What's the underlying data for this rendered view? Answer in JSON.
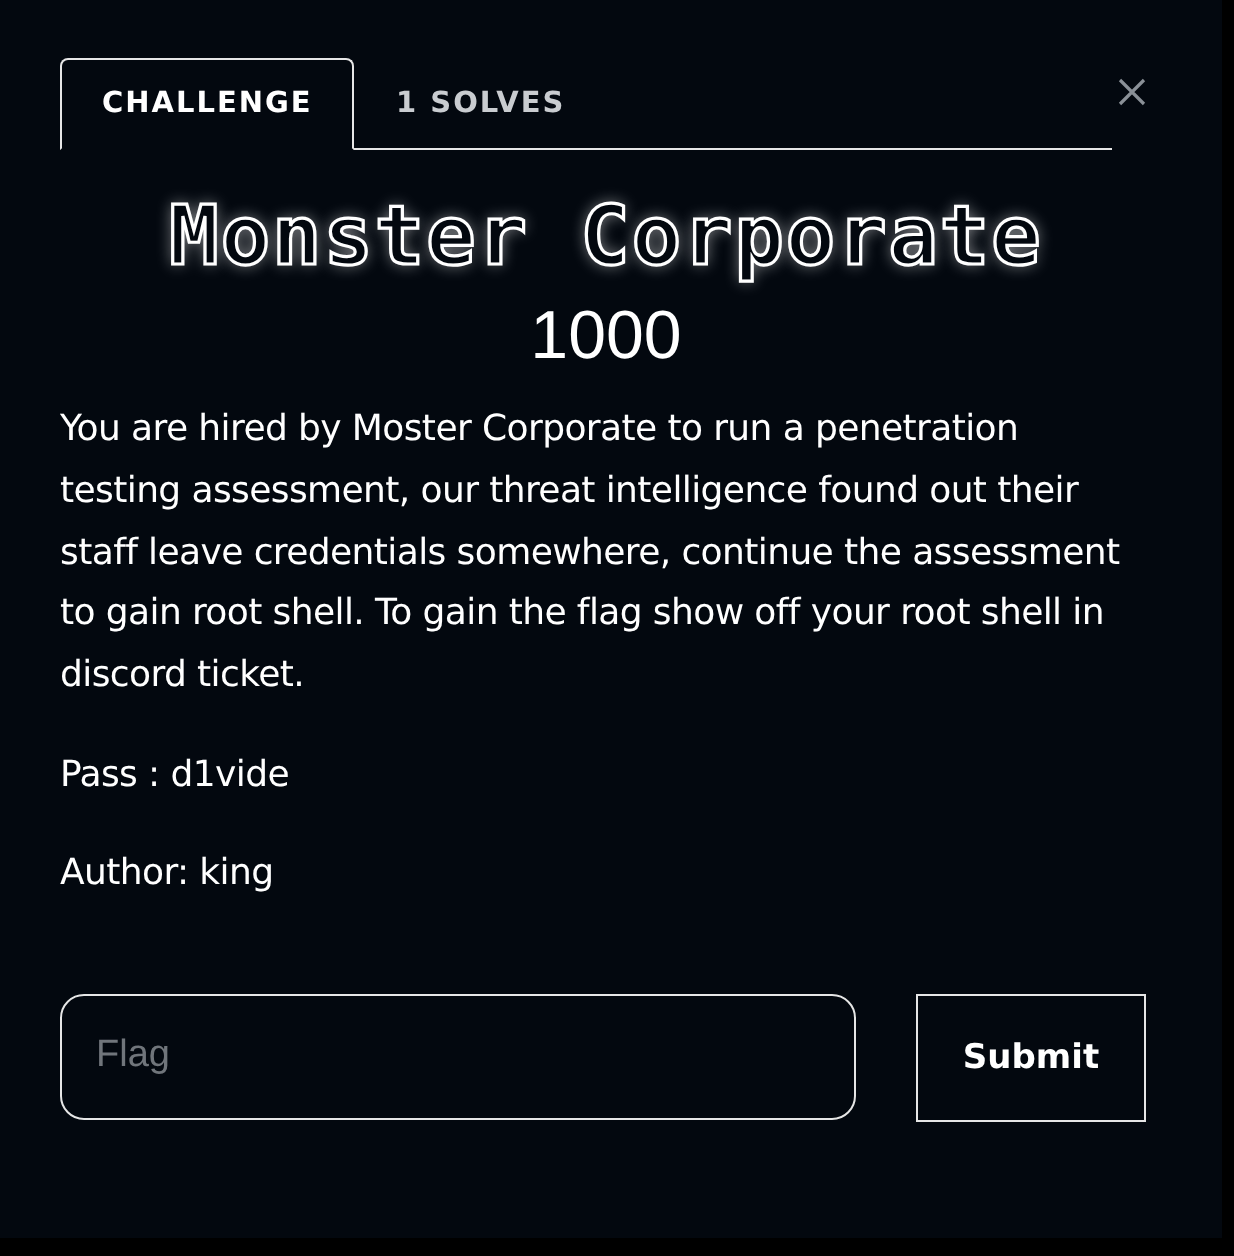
{
  "tabs": [
    {
      "label": "CHALLENGE",
      "selected": true
    },
    {
      "label": "1 SOLVES",
      "selected": false
    }
  ],
  "challenge": {
    "title": "Monster Corporate",
    "points": "1000",
    "description": "You are hired by Moster Corporate to run a penetration testing assessment, our threat intelligence found out their staff leave credentials somewhere, continue the assessment to gain root shell. To gain the flag show off your root shell in discord ticket.",
    "details": [
      "Pass : d1vide",
      "Author: king"
    ]
  },
  "flag_form": {
    "placeholder": "Flag",
    "button": "Submit"
  }
}
